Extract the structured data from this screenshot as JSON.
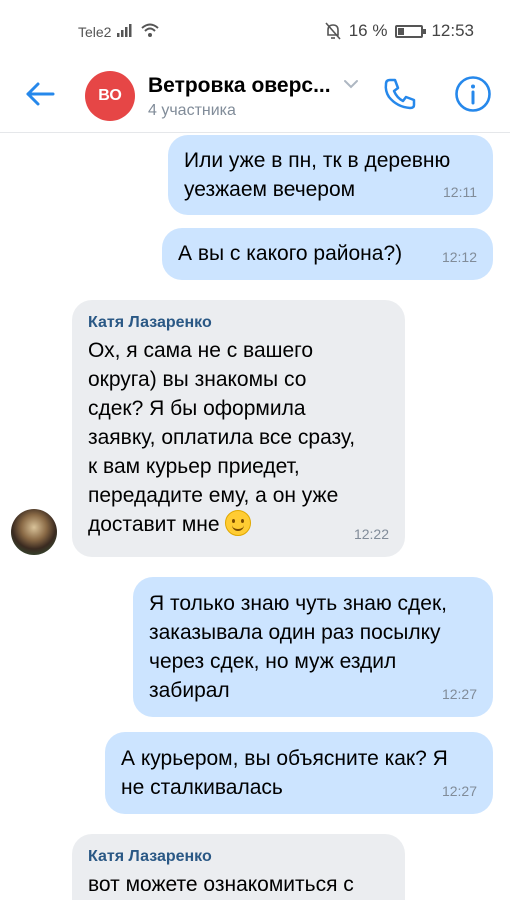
{
  "status": {
    "carrier": "Tele2",
    "battery": "16 %",
    "time": "12:53"
  },
  "header": {
    "avatar_initials": "ВО",
    "title": "Ветровка оверс...",
    "subtitle": "4 участника"
  },
  "messages": [
    {
      "type": "out",
      "text": "Или уже в пн, тк в деревню\nуезжаем вечером",
      "time": "12:11"
    },
    {
      "type": "out",
      "text": "А вы с какого района?)",
      "time": "12:12"
    },
    {
      "type": "in",
      "sender": "Катя Лазаренко",
      "text": "Ох, я сама не с вашего\nокруга) вы знакомы со\nсдек? Я бы оформила\nзаявку, оплатила все сразу,\nк вам курьер приедет,\nпередадите ему, а он уже\nдоставит мне",
      "emoji": "smiling-face",
      "time": "12:22"
    },
    {
      "type": "out",
      "text": "Я только знаю чуть знаю сдек,\nзаказывала один раз посылку\nчерез сдек, но муж ездил\nзабирал",
      "time": "12:27"
    },
    {
      "type": "out",
      "text": "А курьером, вы объясните как? Я\nне сталкивалась",
      "time": "12:27"
    },
    {
      "type": "in",
      "sender": "Катя Лазаренко",
      "text": "вот можете ознакомиться с"
    }
  ],
  "colors": {
    "accent": "#2688eb",
    "outgoing_bubble": "#cce4ff",
    "incoming_bubble": "#ebedf0",
    "avatar_red": "#e64646"
  }
}
